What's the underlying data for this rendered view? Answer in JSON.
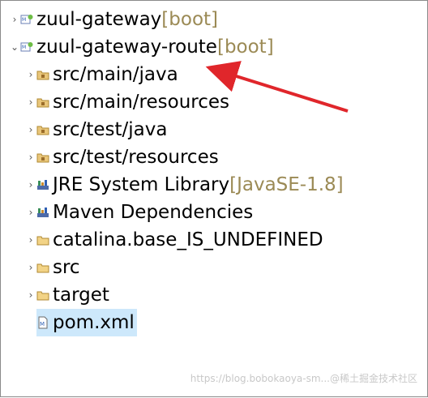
{
  "tree": {
    "projects": [
      {
        "name": "zuul-gateway",
        "decoration": " [boot]",
        "expanded": false
      },
      {
        "name": "zuul-gateway-route",
        "decoration": " [boot]",
        "expanded": true
      }
    ],
    "children": [
      {
        "label": "src/main/java",
        "decoration": "",
        "icon": "source-folder-icon"
      },
      {
        "label": "src/main/resources",
        "decoration": "",
        "icon": "source-folder-icon"
      },
      {
        "label": "src/test/java",
        "decoration": "",
        "icon": "source-folder-icon"
      },
      {
        "label": "src/test/resources",
        "decoration": "",
        "icon": "source-folder-icon"
      },
      {
        "label": "JRE System Library",
        "decoration": " [JavaSE-1.8]",
        "icon": "library-icon"
      },
      {
        "label": "Maven Dependencies",
        "decoration": "",
        "icon": "library-icon"
      },
      {
        "label": "catalina.base_IS_UNDEFINED",
        "decoration": "",
        "icon": "folder-icon"
      },
      {
        "label": "src",
        "decoration": "",
        "icon": "folder-icon"
      },
      {
        "label": "target",
        "decoration": "",
        "icon": "folder-icon"
      },
      {
        "label": "pom.xml",
        "decoration": "",
        "icon": "xml-file-icon"
      }
    ]
  },
  "watermark": "https://blog.bobokaoya-sm...@稀土掘金技术社区",
  "colors": {
    "decoration": "#9b8a55",
    "selection": "#cde8fb",
    "annotation_arrow": "#e0262b"
  }
}
